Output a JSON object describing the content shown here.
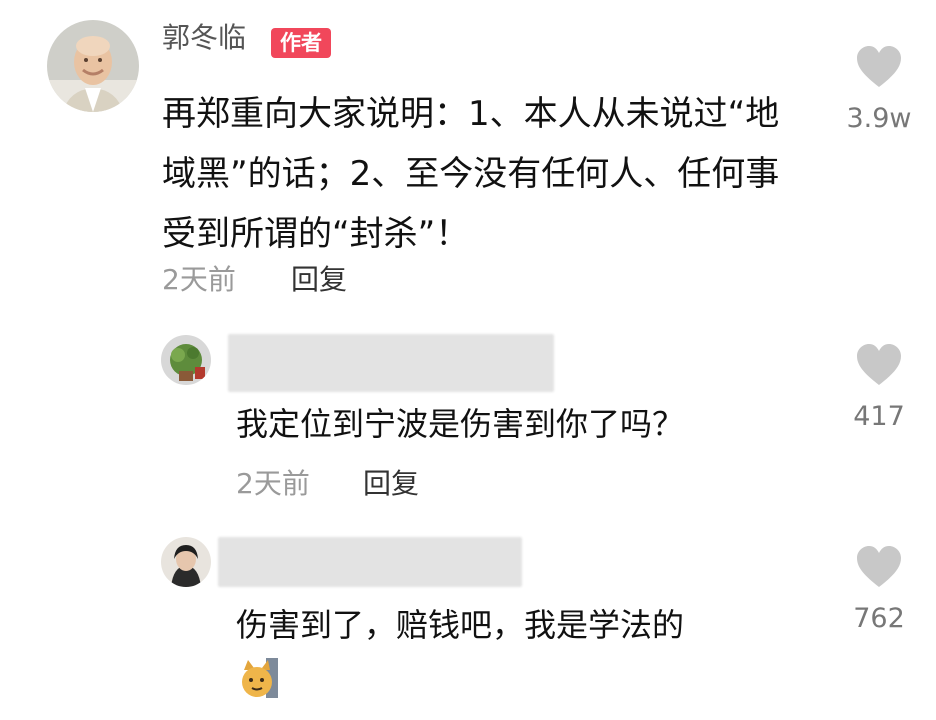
{
  "main_comment": {
    "author": "郭冬临",
    "author_badge": "作者",
    "text": "再郑重向大家说明：1、本人从未说过“地域黑”的话；2、至今没有任何人、任何事受到所谓的“封杀”！",
    "time": "2天前",
    "reply_label": "回复",
    "likes": "3.9w"
  },
  "replies": [
    {
      "text": "我定位到宁波是伤害到你了吗？",
      "time": "2天前",
      "reply_label": "回复",
      "likes": "417"
    },
    {
      "text": "伤害到了，赔钱吧，我是学法的",
      "likes": "762"
    }
  ],
  "colors": {
    "badge": "#f1475b",
    "heart": "#c8c8c8",
    "meta_text": "#9a9a9a"
  },
  "icons": [
    "heart-icon",
    "cat-sticker-icon"
  ]
}
